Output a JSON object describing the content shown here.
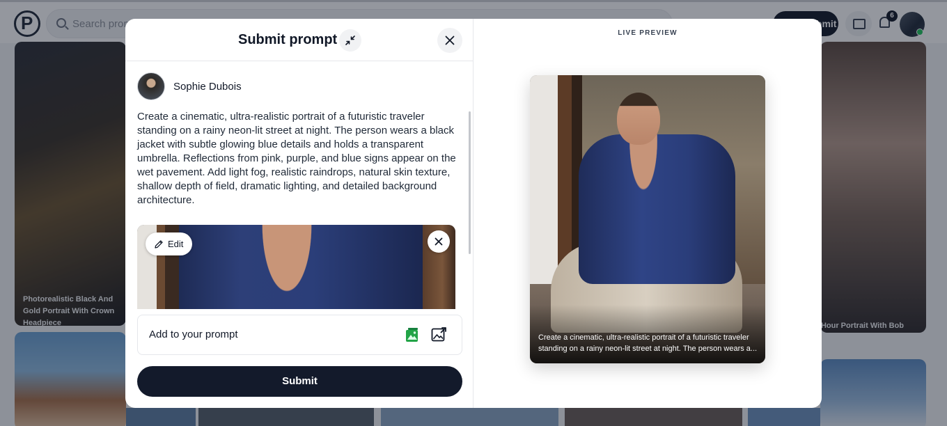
{
  "header": {
    "search_placeholder": "Search prompt",
    "submit_label": "Submit",
    "notification_count": "6"
  },
  "background_cards": [
    {
      "caption": "Photorealistic Black And Gold Portrait With Crown Headpiece"
    },
    {
      "caption": "Golden Hour Portrait With Bob"
    }
  ],
  "modal": {
    "title": "Submit prompt",
    "author_name": "Sophie Dubois",
    "prompt_text": "Create a cinematic, ultra-realistic portrait of a futuristic traveler standing on a rainy neon-lit street at night. The person wears a black jacket with subtle glowing blue details and holds a transparent umbrella. Reflections from pink, purple, and blue signs appear on the wet pavement. Add light fog, realistic raindrops, natural skin texture, shallow depth of field, dramatic lighting, and detailed background architecture.",
    "edit_label": "Edit",
    "add_to_prompt_label": "Add to your prompt",
    "submit_label": "Submit",
    "live_preview_label": "LIVE PREVIEW",
    "preview_caption": "Create a cinematic, ultra-realistic portrait of a futuristic traveler standing on a rainy neon-lit street at night. The person wears a..."
  },
  "colors": {
    "primary_button": "#131a2b",
    "overlay": "rgba(17,24,39,0.45)",
    "generate_icon": "#22a447"
  },
  "icons": {
    "collapse": "collapse-icon",
    "close": "close-icon",
    "edit": "pencil-icon",
    "remove_image": "close-icon",
    "generate_image": "image-generate-icon",
    "upload_image": "image-upload-icon"
  }
}
